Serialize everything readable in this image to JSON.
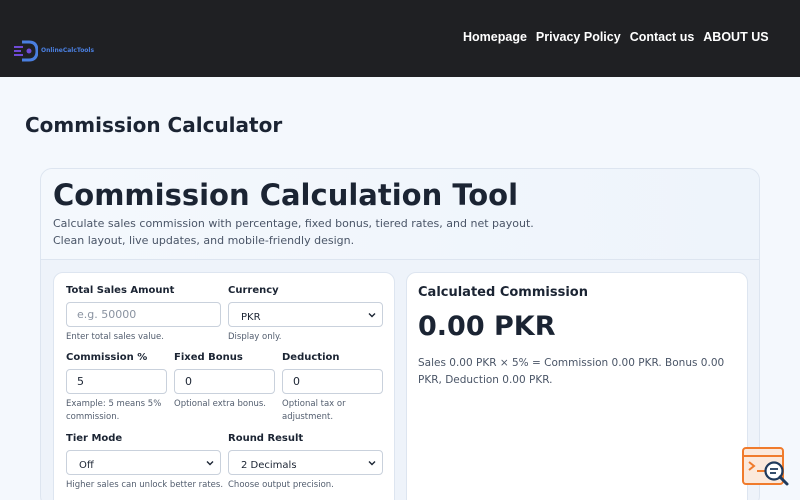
{
  "header": {
    "logo_text": "OnlineCalcTools",
    "nav": [
      "Homepage",
      "Privacy Policy",
      "Contact us",
      "ABOUT US"
    ]
  },
  "page": {
    "title": "Commission Calculator"
  },
  "tool": {
    "title": "Commission Calculation Tool",
    "desc_line1": "Calculate sales commission with percentage, fixed bonus, tiered rates, and net payout.",
    "desc_line2": "Clean layout, live updates, and mobile-friendly design."
  },
  "form": {
    "sales": {
      "label": "Total Sales Amount",
      "placeholder": "e.g. 50000",
      "hint": "Enter total sales value."
    },
    "currency": {
      "label": "Currency",
      "value": "PKR",
      "hint": "Display only."
    },
    "commission": {
      "label": "Commission %",
      "value": "5",
      "hint": "Example: 5 means 5% commission."
    },
    "bonus": {
      "label": "Fixed Bonus",
      "value": "0",
      "hint": "Optional extra bonus."
    },
    "deduction": {
      "label": "Deduction",
      "value": "0",
      "hint": "Optional tax or adjustment."
    },
    "tier": {
      "label": "Tier Mode",
      "value": "Off",
      "hint": "Higher sales can unlock better rates."
    },
    "round": {
      "label": "Round Result",
      "value": "2 Decimals",
      "hint": "Choose output precision."
    }
  },
  "result": {
    "title": "Calculated Commission",
    "value": "0.00 PKR",
    "detail": "Sales 0.00 PKR × 5% = Commission 0.00 PKR. Bonus 0.00 PKR, Deduction 0.00 PKR."
  },
  "colors": {
    "topbar": "#1f2023",
    "page_bg": "#f4f8fd",
    "text": "#1b2433",
    "logo_blue": "#4a7fe0",
    "widget_orange": "#f07b2c"
  }
}
